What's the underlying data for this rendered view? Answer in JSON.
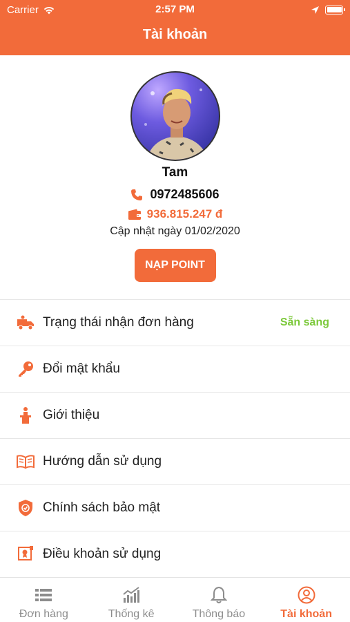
{
  "status_bar": {
    "carrier": "Carrier",
    "time": "2:57 PM"
  },
  "header": {
    "title": "Tài khoản"
  },
  "profile": {
    "name": "Tam",
    "phone": "0972485606",
    "balance": "936.815.247 đ",
    "updated": "Cập nhật ngày 01/02/2020",
    "topup_label": "NẠP POINT"
  },
  "menu": {
    "items": [
      {
        "label": "Trạng thái nhận đơn hàng",
        "status": "Sẵn sàng",
        "icon": "delivery-truck-icon"
      },
      {
        "label": "Đổi mật khẩu",
        "icon": "key-icon"
      },
      {
        "label": "Giới thiệu",
        "icon": "podium-icon"
      },
      {
        "label": "Hướng dẫn sử dụng",
        "icon": "open-book-icon"
      },
      {
        "label": "Chính sách bảo mật",
        "icon": "shield-check-icon"
      },
      {
        "label": "Điều khoản sử dụng",
        "icon": "certificate-icon"
      }
    ]
  },
  "tabbar": {
    "tabs": [
      {
        "label": "Đơn hàng",
        "icon": "list-icon"
      },
      {
        "label": "Thống kê",
        "icon": "chart-icon"
      },
      {
        "label": "Thông báo",
        "icon": "bell-icon"
      },
      {
        "label": "Tài khoản",
        "icon": "user-circle-icon",
        "active": true
      }
    ]
  },
  "colors": {
    "accent": "#f26b3a",
    "status_ready": "#7cc93b",
    "inactive": "#8c8c8c"
  }
}
